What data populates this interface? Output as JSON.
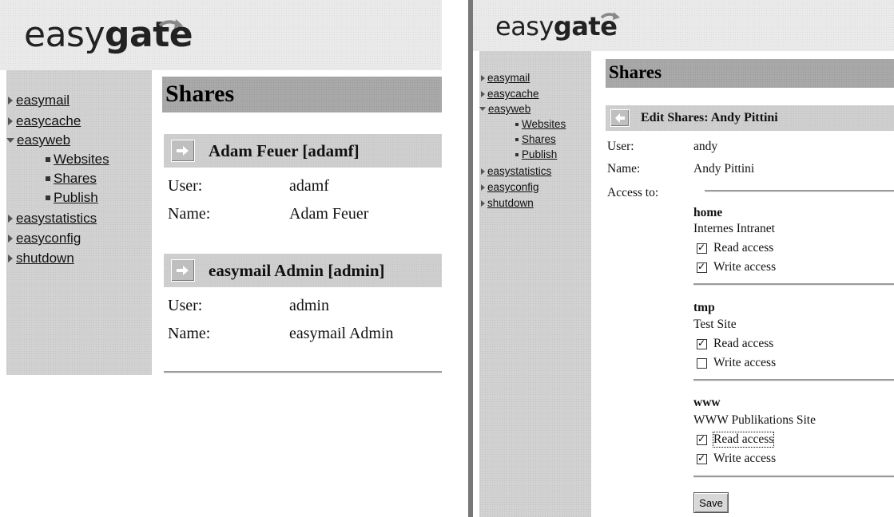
{
  "brand": {
    "logo_normal": "easy",
    "logo_bold": "gate"
  },
  "nav": {
    "items": [
      {
        "label": "easymail",
        "state": "collapsed"
      },
      {
        "label": "easycache",
        "state": "collapsed"
      },
      {
        "label": "easyweb",
        "state": "expanded"
      },
      {
        "label": "Websites",
        "state": "child"
      },
      {
        "label": "Shares",
        "state": "child"
      },
      {
        "label": "Publish",
        "state": "child"
      },
      {
        "label": "easystatistics",
        "state": "collapsed"
      },
      {
        "label": "easyconfig",
        "state": "collapsed"
      },
      {
        "label": "shutdown",
        "state": "collapsed"
      }
    ]
  },
  "left_panel": {
    "title": "Shares",
    "users": [
      {
        "header": "Adam Feuer [adamf]",
        "user_label": "User:",
        "user_value": "adamf",
        "name_label": "Name:",
        "name_value": "Adam Feuer"
      },
      {
        "header": "easymail Admin [admin]",
        "user_label": "User:",
        "user_value": "admin",
        "name_label": "Name:",
        "name_value": "easymail Admin"
      }
    ]
  },
  "right_panel": {
    "title": "Shares",
    "subheader": "Edit Shares: Andy Pittini",
    "user_label": "User:",
    "user_value": "andy",
    "name_label": "Name:",
    "name_value": "Andy Pittini",
    "access_label": "Access to:",
    "shares": [
      {
        "name": "home",
        "description": "Internes Intranet",
        "read_label": "Read access",
        "read": true,
        "write_label": "Write access",
        "write": true
      },
      {
        "name": "tmp",
        "description": "Test Site",
        "read_label": "Read access",
        "read": true,
        "write_label": "Write access",
        "write": false
      },
      {
        "name": "www",
        "description": "WWW Publikations Site",
        "read_label": "Read access",
        "read": true,
        "write_label": "Write access",
        "write": true
      }
    ],
    "save_label": "Save"
  },
  "icons": {
    "logo_arrow": "curved-arrow-icon",
    "header_arrow_right": "arrow-right-icon",
    "header_arrow_left": "arrow-left-icon"
  }
}
